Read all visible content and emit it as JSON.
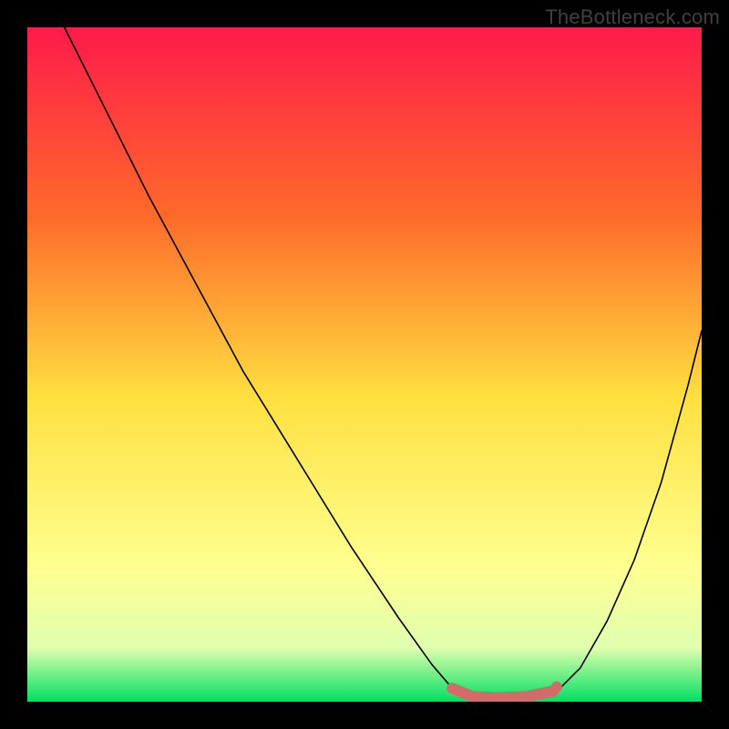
{
  "watermark": "TheBottleneck.com",
  "chart_data": {
    "type": "line",
    "title": "",
    "xlabel": "",
    "ylabel": "",
    "xlim": [
      0,
      100
    ],
    "ylim": [
      0,
      100
    ],
    "gradient_colors": {
      "top": "#ff1a4a",
      "mid_upper": "#ff8a2a",
      "mid": "#ffe040",
      "mid_lower": "#ffff80",
      "bottom": "#00e060"
    },
    "series": [
      {
        "name": "left-curve",
        "stroke": "#000000",
        "width": 1.6,
        "points": [
          {
            "x": 5.5,
            "y": 100.0
          },
          {
            "x": 8.0,
            "y": 95.0
          },
          {
            "x": 12.0,
            "y": 87.0
          },
          {
            "x": 18.0,
            "y": 75.0
          },
          {
            "x": 25.0,
            "y": 62.0
          },
          {
            "x": 32.0,
            "y": 49.0
          },
          {
            "x": 40.0,
            "y": 36.0
          },
          {
            "x": 48.0,
            "y": 23.0
          },
          {
            "x": 55.0,
            "y": 12.5
          },
          {
            "x": 60.0,
            "y": 5.5
          },
          {
            "x": 63.0,
            "y": 2.0
          }
        ]
      },
      {
        "name": "right-curve",
        "stroke": "#000000",
        "width": 1.6,
        "points": [
          {
            "x": 79.0,
            "y": 2.0
          },
          {
            "x": 82.0,
            "y": 5.0
          },
          {
            "x": 86.0,
            "y": 12.0
          },
          {
            "x": 90.0,
            "y": 21.0
          },
          {
            "x": 94.0,
            "y": 32.5
          },
          {
            "x": 98.0,
            "y": 47.0
          },
          {
            "x": 100.0,
            "y": 55.0
          }
        ]
      },
      {
        "name": "bottom-region",
        "stroke": "#d46a6a",
        "width": 12.0,
        "points": [
          {
            "x": 63.0,
            "y": 2.0
          },
          {
            "x": 66.0,
            "y": 0.8
          },
          {
            "x": 70.0,
            "y": 0.6
          },
          {
            "x": 74.0,
            "y": 0.8
          },
          {
            "x": 78.0,
            "y": 1.6
          }
        ]
      }
    ],
    "marker": {
      "x": 78.5,
      "y": 2.2,
      "r": 6,
      "fill": "#d46a6a"
    }
  }
}
